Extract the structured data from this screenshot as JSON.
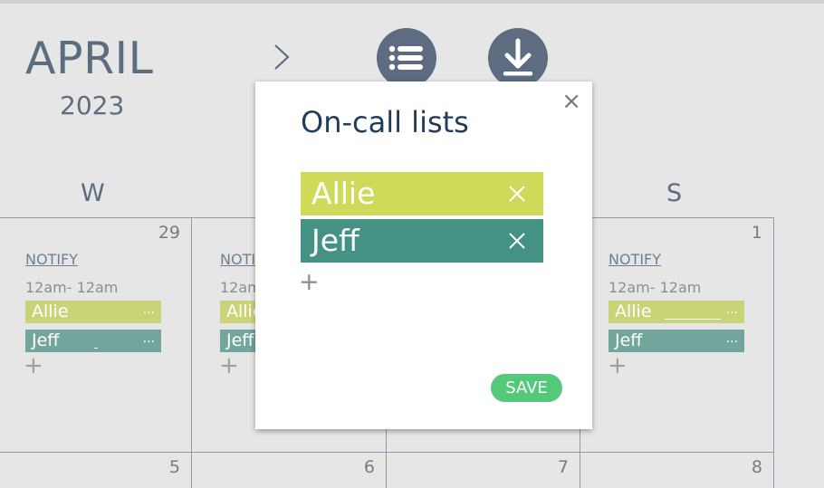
{
  "header": {
    "month": "APRIL",
    "year": "2023",
    "next_icon": "chevron-right-icon",
    "list_button_icon": "list-icon",
    "download_button_icon": "download-icon",
    "accent_color": "#5d6c80"
  },
  "weekdays": [
    "W",
    "S"
  ],
  "calendar": {
    "cells": [
      {
        "date": "29",
        "notify": "NOTIFY",
        "time": "12am- 12am",
        "shifts": [
          {
            "name": "Allie",
            "menu": "..."
          },
          {
            "name": "Jeff",
            "menu": "..."
          }
        ],
        "add": "+"
      },
      {
        "notify": "NOTI",
        "time": "12am",
        "shifts": [
          {
            "name": "Allie"
          },
          {
            "name": "Jeff"
          }
        ],
        "add": "+"
      },
      {
        "date": "1",
        "notify": "NOTIFY",
        "time": "12am- 12am",
        "shifts": [
          {
            "name": "Allie",
            "menu": "..."
          },
          {
            "name": "Jeff",
            "menu": "..."
          }
        ],
        "add": "+"
      }
    ],
    "next_row_dates": [
      "5",
      "6",
      "7",
      "8"
    ]
  },
  "modal": {
    "title": "On-call lists",
    "close": "×",
    "entries": [
      {
        "name": "Allie",
        "color": "#d0da5a"
      },
      {
        "name": "Jeff",
        "color": "#439283"
      }
    ],
    "add": "+",
    "save_label": "SAVE",
    "save_color": "#55c97a"
  }
}
